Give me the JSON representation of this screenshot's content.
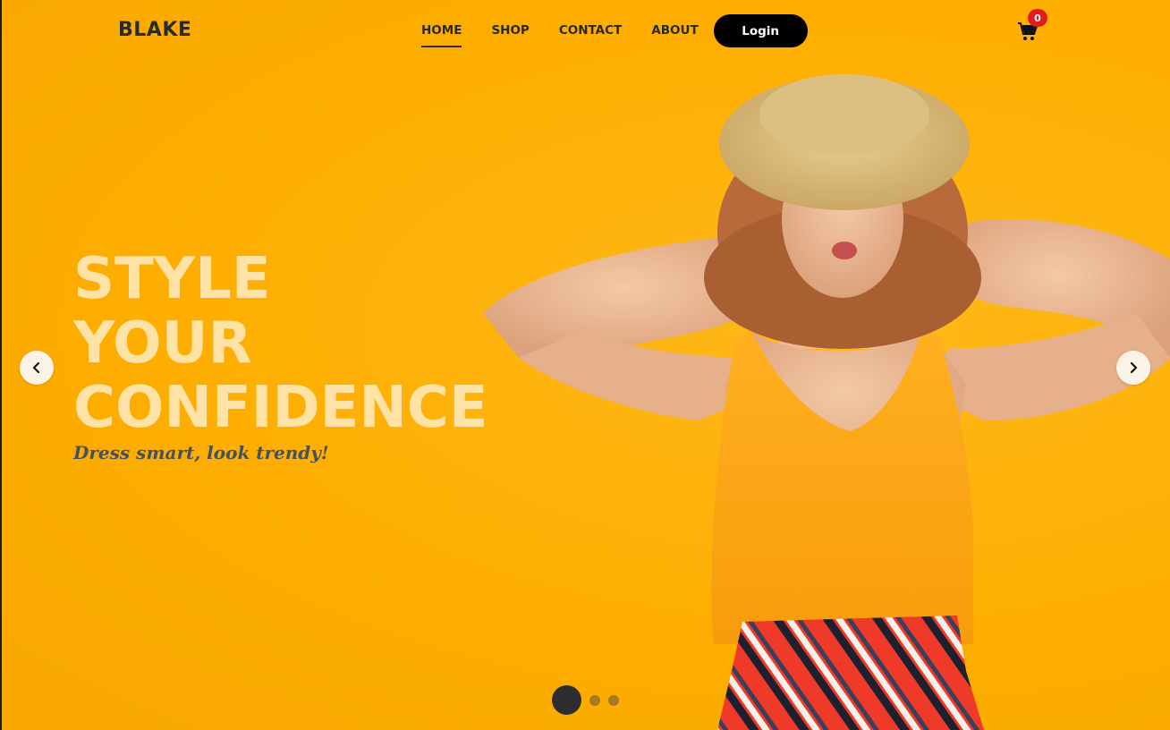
{
  "brand": {
    "logo": "BLAKE"
  },
  "nav": {
    "items": [
      {
        "label": "HOME",
        "active": true
      },
      {
        "label": "SHOP",
        "active": false
      },
      {
        "label": "CONTACT",
        "active": false
      },
      {
        "label": "ABOUT",
        "active": false
      }
    ],
    "login_label": "Login"
  },
  "cart": {
    "count": "0",
    "icon": "cart-icon"
  },
  "hero": {
    "headline": [
      "STYLE",
      "YOUR",
      "CONFIDENCE"
    ],
    "tagline": "Dress smart, look trendy!",
    "slide_count": 3,
    "active_slide": 1
  },
  "colors": {
    "background": "#fdaf02",
    "headline": "#ffe3a6",
    "tagline": "#455060",
    "badge": "#e21b1b",
    "button": "#000000"
  }
}
